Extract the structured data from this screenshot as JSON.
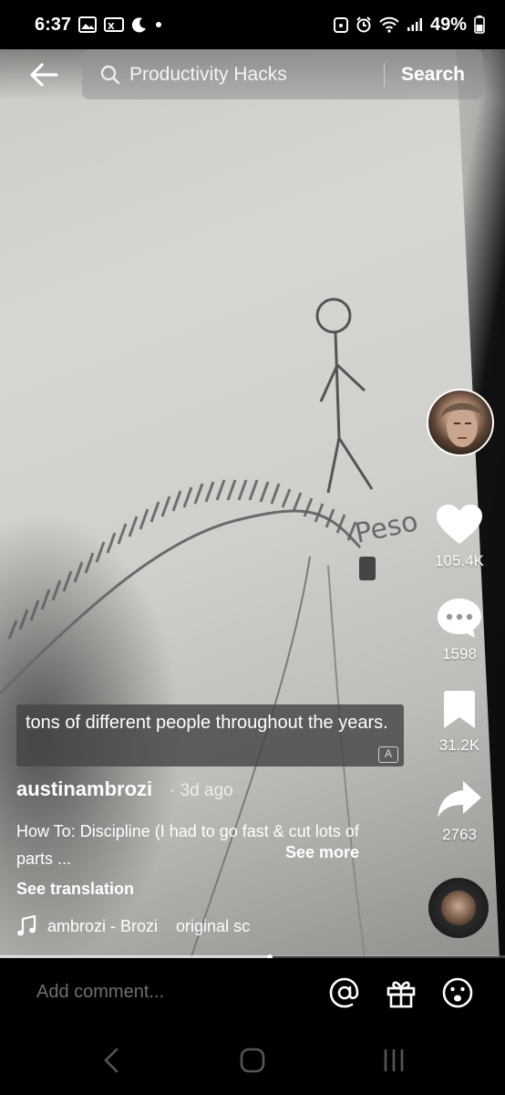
{
  "status_bar": {
    "time": "6:37",
    "battery": "49%"
  },
  "search": {
    "query": "Productivity Hacks",
    "button_label": "Search"
  },
  "rail": {
    "likes": "105.4K",
    "comments": "1598",
    "saves": "31.2K",
    "shares": "2763"
  },
  "caption": {
    "text": "tons of different people throughout the years.",
    "badge": "A"
  },
  "post": {
    "username": "austinambrozi",
    "posted": "· 3d ago",
    "description": "How To: Discipline (I had to go fast & cut lots of parts ...",
    "see_more": "See more",
    "see_translation": "See translation",
    "music_artist": "ambrozi - Brozi",
    "music_track": "original sc"
  },
  "progress": {
    "fraction": 0.535
  },
  "comment_bar": {
    "placeholder": "Add comment..."
  },
  "sketch_text": "Peso",
  "icons": [
    "back-arrow-icon",
    "search-icon",
    "heart-icon",
    "comment-icon",
    "bookmark-icon",
    "share-icon",
    "music-note-icon",
    "at-icon",
    "gift-icon",
    "emoji-icon",
    "nav-back-icon",
    "nav-home-icon",
    "nav-recents-icon"
  ],
  "colors": {
    "background": "#000000",
    "text": "#ffffff",
    "placeholder": "#6f6f6f"
  }
}
